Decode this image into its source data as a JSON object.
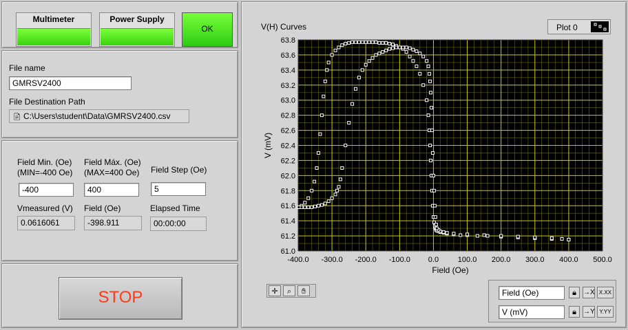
{
  "buttons": {
    "multimeter_label": "Multimeter",
    "power_supply_label": "Power Supply",
    "ok_label": "OK",
    "stop_label": "STOP"
  },
  "file": {
    "name_label": "File name",
    "name_value": "GMRSV2400",
    "path_label": "File Destination Path",
    "path_value": "C:\\Users\\student\\Data\\GMRSV2400.csv"
  },
  "params": {
    "field_min_label_1": "Field Min. (Oe)",
    "field_min_label_2": "(MIN=-400 Oe)",
    "field_min_value": "-400",
    "field_max_label_1": "Field Máx. (Oe)",
    "field_max_label_2": "(MAX=400 Oe)",
    "field_max_value": "400",
    "field_step_label": "Field Step (Oe)",
    "field_step_value": "5",
    "vmeasured_label": "Vmeasured (V)",
    "vmeasured_value": "0.0616061",
    "field_label": "Field (Oe)",
    "field_value": "-398.911",
    "elapsed_label": "Elapsed Time",
    "elapsed_value": "00:00:00"
  },
  "graph": {
    "title": "V(H) Curves",
    "legend_label": "Plot 0",
    "xscale_name": "Field (Oe)",
    "yscale_name": "V (mV)",
    "xscale_fmt": "X.XX",
    "yscale_fmt": "Y.YY"
  },
  "colors": {
    "plot_bg": "#000000",
    "grid_major": "#c8c800",
    "grid_minor": "#6a6a00",
    "led_green": "#4ee020",
    "stop_text": "#ff3a1a"
  },
  "chart_data": {
    "type": "scatter",
    "title": "V(H) Curves",
    "xlabel": "Field (Oe)",
    "ylabel": "V (mV)",
    "xlim": [
      -400,
      500
    ],
    "ylim": [
      61.0,
      63.8
    ],
    "xticks": [
      "-400.0",
      "-300.0",
      "-200.0",
      "-100.0",
      "0.0",
      "100.0",
      "200.0",
      "300.0",
      "400.0",
      "500.0"
    ],
    "yticks": [
      "61.0",
      "61.2",
      "61.4",
      "61.6",
      "61.8",
      "62.0",
      "62.2",
      "62.4",
      "62.6",
      "62.8",
      "63.0",
      "63.2",
      "63.4",
      "63.6",
      "63.8"
    ],
    "grid": true,
    "legend": "top-right",
    "series": [
      {
        "name": "Plot 0",
        "x": [
          -398,
          -390,
          -380,
          -370,
          -360,
          -352,
          -345,
          -340,
          -335,
          -330,
          -325,
          -320,
          -315,
          -310,
          -300,
          -290,
          -280,
          -270,
          -260,
          -250,
          -240,
          -230,
          -220,
          -210,
          -200,
          -190,
          -180,
          -170,
          -160,
          -150,
          -140,
          -130,
          -120,
          -110,
          -100,
          -90,
          -80,
          -70,
          -60,
          -50,
          -40,
          -30,
          -20,
          -15,
          -12,
          -10,
          -8,
          -6,
          -4,
          -2,
          0,
          2,
          4,
          6,
          8,
          10,
          15,
          20,
          30,
          40,
          60,
          80,
          100,
          130,
          160,
          200,
          250,
          300,
          350,
          400,
          400,
          380,
          350,
          300,
          250,
          200,
          150,
          100,
          60,
          40,
          30,
          20,
          15,
          10,
          8,
          6,
          4,
          2,
          0,
          -2,
          -4,
          -6,
          -8,
          -10,
          -12,
          -15,
          -20,
          -30,
          -40,
          -50,
          -60,
          -70,
          -80,
          -90,
          -100,
          -110,
          -120,
          -130,
          -140,
          -150,
          -160,
          -170,
          -180,
          -190,
          -200,
          -210,
          -220,
          -230,
          -240,
          -250,
          -260,
          -270,
          -275,
          -280,
          -285,
          -290,
          -300,
          -310,
          -320,
          -330,
          -340,
          -350,
          -360,
          -370,
          -380,
          -390,
          -398
        ],
        "y": [
          61.58,
          61.6,
          61.64,
          61.7,
          61.8,
          61.92,
          62.1,
          62.3,
          62.55,
          62.8,
          63.05,
          63.25,
          63.4,
          63.5,
          63.6,
          63.66,
          63.7,
          63.73,
          63.75,
          63.76,
          63.77,
          63.77,
          63.77,
          63.77,
          63.77,
          63.77,
          63.77,
          63.77,
          63.76,
          63.76,
          63.76,
          63.75,
          63.74,
          63.72,
          63.7,
          63.68,
          63.64,
          63.58,
          63.52,
          63.45,
          63.35,
          63.2,
          63.0,
          62.8,
          62.6,
          62.4,
          62.2,
          62.0,
          61.8,
          61.6,
          61.45,
          61.38,
          61.33,
          61.3,
          61.28,
          61.27,
          61.26,
          61.25,
          61.24,
          61.23,
          61.22,
          61.21,
          61.21,
          61.2,
          61.2,
          61.19,
          61.18,
          61.17,
          61.16,
          61.15,
          61.15,
          61.16,
          61.17,
          61.18,
          61.19,
          61.2,
          61.21,
          61.22,
          61.23,
          61.24,
          61.25,
          61.26,
          61.28,
          61.3,
          61.35,
          61.45,
          61.6,
          61.8,
          62.0,
          62.3,
          62.6,
          62.9,
          63.1,
          63.25,
          63.35,
          63.45,
          63.52,
          63.58,
          63.62,
          63.65,
          63.67,
          63.69,
          63.7,
          63.7,
          63.7,
          63.7,
          63.69,
          63.68,
          63.66,
          63.64,
          63.62,
          63.6,
          63.56,
          63.52,
          63.47,
          63.4,
          63.3,
          63.15,
          62.95,
          62.7,
          62.4,
          62.1,
          61.95,
          61.85,
          61.8,
          61.75,
          61.7,
          61.66,
          61.63,
          61.61,
          61.6,
          61.59,
          61.58,
          61.58,
          61.58,
          61.58,
          61.58
        ]
      }
    ]
  }
}
